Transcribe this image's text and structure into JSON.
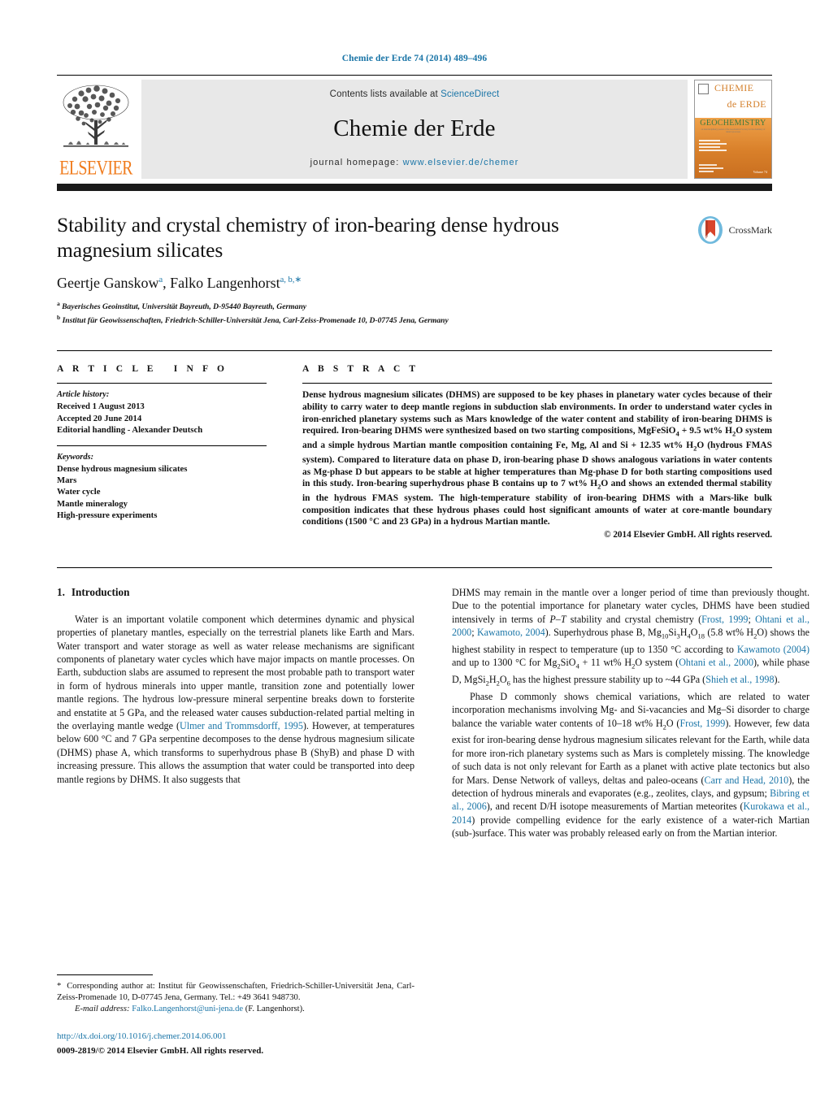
{
  "running_head": "Chemie der Erde 74 (2014) 489–496",
  "masthead": {
    "contents_prefix": "Contents lists available at ",
    "contents_link": "ScienceDirect",
    "journal_title": "Chemie der Erde",
    "homepage_prefix": "journal homepage:",
    "homepage_url": "www.elsevier.de/chemer",
    "publisher": "ELSEVIER",
    "cover": {
      "line1": "CHEMIE",
      "line2": "de ERDE",
      "line3": "GEOCHEMISTRY",
      "tagline": "an interdisciplinary journal of the Geochemical Society for the chemistry of natural processes"
    }
  },
  "title": "Stability and crystal chemistry of iron-bearing dense hydrous magnesium silicates",
  "crossmark_label": "CrossMark",
  "authors": [
    {
      "name": "Geertje Ganskow",
      "marks": "a"
    },
    {
      "name": "Falko Langenhorst",
      "marks": "a, b,"
    }
  ],
  "authors_line": "Geertje Ganskow, Falko Langenhorst",
  "affiliations": [
    {
      "mark": "a",
      "text": "Bayerisches Geoinstitut, Universität Bayreuth, D-95440 Bayreuth, Germany"
    },
    {
      "mark": "b",
      "text": "Institut für Geowissenschaften, Friedrich-Schiller-Universität Jena, Carl-Zeiss-Promenade 10, D-07745 Jena, Germany"
    }
  ],
  "article_info": {
    "heading": "ARTICLE INFO",
    "history_label": "Article history:",
    "history": [
      "Received 1 August 2013",
      "Accepted 20 June 2014",
      "Editorial handling - Alexander Deutsch"
    ],
    "keywords_label": "Keywords:",
    "keywords": [
      "Dense hydrous magnesium silicates",
      "Mars",
      "Water cycle",
      "Mantle mineralogy",
      "High-pressure experiments"
    ]
  },
  "abstract": {
    "heading": "ABSTRACT",
    "text": "Dense hydrous magnesium silicates (DHMS) are supposed to be key phases in planetary water cycles because of their ability to carry water to deep mantle regions in subduction slab environments. In order to understand water cycles in iron-enriched planetary systems such as Mars knowledge of the water content and stability of iron-bearing DHMS is required. Iron-bearing DHMS were synthesized based on two starting compositions, MgFeSiO4 + 9.5 wt% H2O system and a simple hydrous Martian mantle composition containing Fe, Mg, Al and Si + 12.35 wt% H2O (hydrous FMAS system). Compared to literature data on phase D, iron-bearing phase D shows analogous variations in water contents as Mg-phase D but appears to be stable at higher temperatures than Mg-phase D for both starting compositions used in this study. Iron-bearing superhydrous phase B contains up to 7 wt% H2O and shows an extended thermal stability in the hydrous FMAS system. The high-temperature stability of iron-bearing DHMS with a Mars-like bulk composition indicates that these hydrous phases could host significant amounts of water at core-mantle boundary conditions (1500 °C and 23 GPa) in a hydrous Martian mantle.",
    "copyright": "© 2014 Elsevier GmbH. All rights reserved."
  },
  "section": {
    "number": "1.",
    "heading": "Introduction"
  },
  "body": {
    "left_p1": "Water is an important volatile component which determines dynamic and physical properties of planetary mantles, especially on the terrestrial planets like Earth and Mars. Water transport and water storage as well as water release mechanisms are significant components of planetary water cycles which have major impacts on mantle processes. On Earth, subduction slabs are assumed to represent the most probable path to transport water in form of hydrous minerals into upper mantle, transition zone and potentially lower mantle regions. The hydrous low-pressure mineral serpentine breaks down to forsterite and enstatite at 5 GPa, and the released water causes subduction-related partial melting in the overlaying mantle wedge (Ulmer and Trommsdorff, 1995). However, at temperatures below 600 °C and 7 GPa serpentine decomposes to the dense hydrous magnesium silicate (DHMS) phase A, which transforms to superhydrous phase B (ShyB) and phase D with increasing pressure. This allows the assumption that water could be transported into deep mantle regions by DHMS. It also suggests that",
    "right_p1": "DHMS may remain in the mantle over a longer period of time than previously thought. Due to the potential importance for planetary water cycles, DHMS have been studied intensively in terms of P–T stability and crystal chemistry (Frost, 1999; Ohtani et al., 2000; Kawamoto, 2004). Superhydrous phase B, Mg10Si3H4O18 (5.8 wt% H2O) shows the highest stability in respect to temperature (up to 1350 °C according to Kawamoto (2004) and up to 1300 °C for Mg2SiO4 + 11 wt% H2O system (Ohtani et al., 2000), while phase D, MgSi2H2O6 has the highest pressure stability up to ~44 GPa (Shieh et al., 1998).",
    "right_p2": "Phase D commonly shows chemical variations, which are related to water incorporation mechanisms involving Mg- and Si-vacancies and Mg–Si disorder to charge balance the variable water contents of 10–18 wt% H2O (Frost, 1999). However, few data exist for iron-bearing dense hydrous magnesium silicates relevant for the Earth, while data for more iron-rich planetary systems such as Mars is completely missing. The knowledge of such data is not only relevant for Earth as a planet with active plate tectonics but also for Mars. Dense Network of valleys, deltas and paleo-oceans (Carr and Head, 2010), the detection of hydrous minerals and evaporates (e.g., zeolites, clays, and gypsum; Bibring et al., 2006), and recent D/H isotope measurements of Martian meteorites (Kurokawa et al., 2014) provide compelling evidence for the early existence of a water-rich Martian (sub-)surface. This water was probably released early on from the Martian interior."
  },
  "footnote": {
    "star": "*",
    "corresponding": "Corresponding author at: Institut für Geowissenschaften, Friedrich-Schiller-Universität Jena, Carl-Zeiss-Promenade 10, D-07745 Jena, Germany.",
    "tel": "Tel.: +49 3641 948730.",
    "email_label": "E-mail address:",
    "email": "Falko.Langenhorst@uni-jena.de",
    "email_suffix": "(F. Langenhorst)."
  },
  "doi": {
    "url": "http://dx.doi.org/10.1016/j.chemer.2014.06.001",
    "issn_line": "0009-2819/© 2014 Elsevier GmbH. All rights reserved."
  },
  "colors": {
    "link": "#1a75a7",
    "elsevier_orange": "#f07c1e",
    "banner_gray": "#e8e8e8",
    "cover_orange": "#d4802c",
    "cover_green": "#3d7a3d"
  }
}
